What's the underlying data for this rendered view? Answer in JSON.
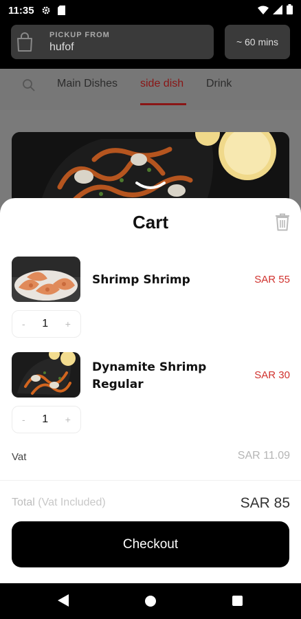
{
  "status_bar": {
    "time": "11:35"
  },
  "header": {
    "pickup_label": "PICKUP FROM",
    "pickup_value": "hufof",
    "eta": "~ 60 mins"
  },
  "tabs": [
    {
      "label": "Main Dishes"
    },
    {
      "label": "side dish",
      "active": true
    },
    {
      "label": "Drink"
    }
  ],
  "cart": {
    "title": "Cart",
    "items": [
      {
        "name": "Shrimp Shrimp",
        "price": "SAR 55",
        "qty": "1"
      },
      {
        "name": "Dynamite Shrimp Regular",
        "price": "SAR 30",
        "qty": "1"
      }
    ],
    "stepper_minus": "-",
    "stepper_plus": "+",
    "vat_label": "Vat",
    "vat_value": "SAR 11.09",
    "total_label": "Total",
    "total_sublabel": "(Vat Included)",
    "total_value": "SAR 85",
    "checkout_label": "Checkout"
  },
  "colors": {
    "accent": "#d0312d",
    "button_bg": "#000000"
  }
}
